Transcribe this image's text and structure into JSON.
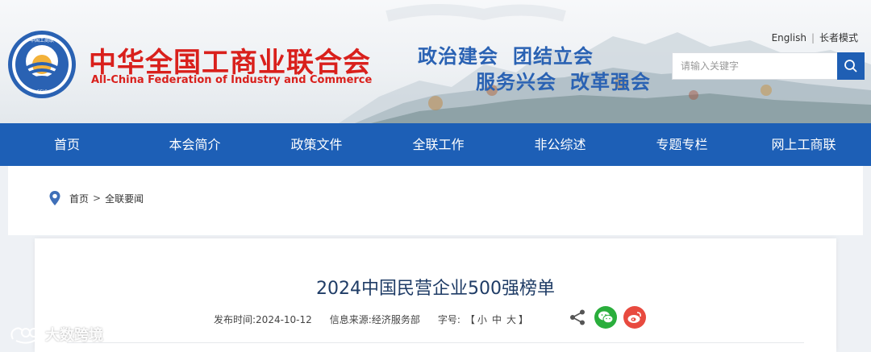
{
  "header": {
    "org_name_cn": "中华全国工商业联合会",
    "org_name_en": "All-China Federation of Industry and Commerce",
    "logo_text_top": "中国工商联",
    "logo_text_bottom": "CFIC",
    "slogans": [
      "政治建会",
      "团结立会",
      "服务兴会",
      "改革强会"
    ],
    "links": {
      "english": "English",
      "elder_mode": "长者模式"
    },
    "search": {
      "placeholder": "请输入关键字"
    }
  },
  "nav": {
    "items": [
      "首页",
      "本会简介",
      "政策文件",
      "全联工作",
      "非公综述",
      "专题专栏",
      "网上工商联"
    ]
  },
  "breadcrumb": {
    "home": "首页",
    "separator": ">",
    "current": "全联要闻"
  },
  "article": {
    "title": "2024中国民营企业500强榜单",
    "publish_label": "发布时间:",
    "publish_date": "2024-10-12",
    "source_label": "信息来源:",
    "source": "经济服务部",
    "font_label": "字号:",
    "font_open": "【",
    "font_sizes": [
      "小",
      "中",
      "大"
    ],
    "font_close": "】"
  },
  "watermark": {
    "text": "大数跨境"
  },
  "colors": {
    "brand_red": "#d9201c",
    "nav_blue": "#1d5fb6",
    "slogan_blue": "#2a62b3",
    "wechat_green": "#2aae3c",
    "weibo_red": "#e84a3f"
  }
}
